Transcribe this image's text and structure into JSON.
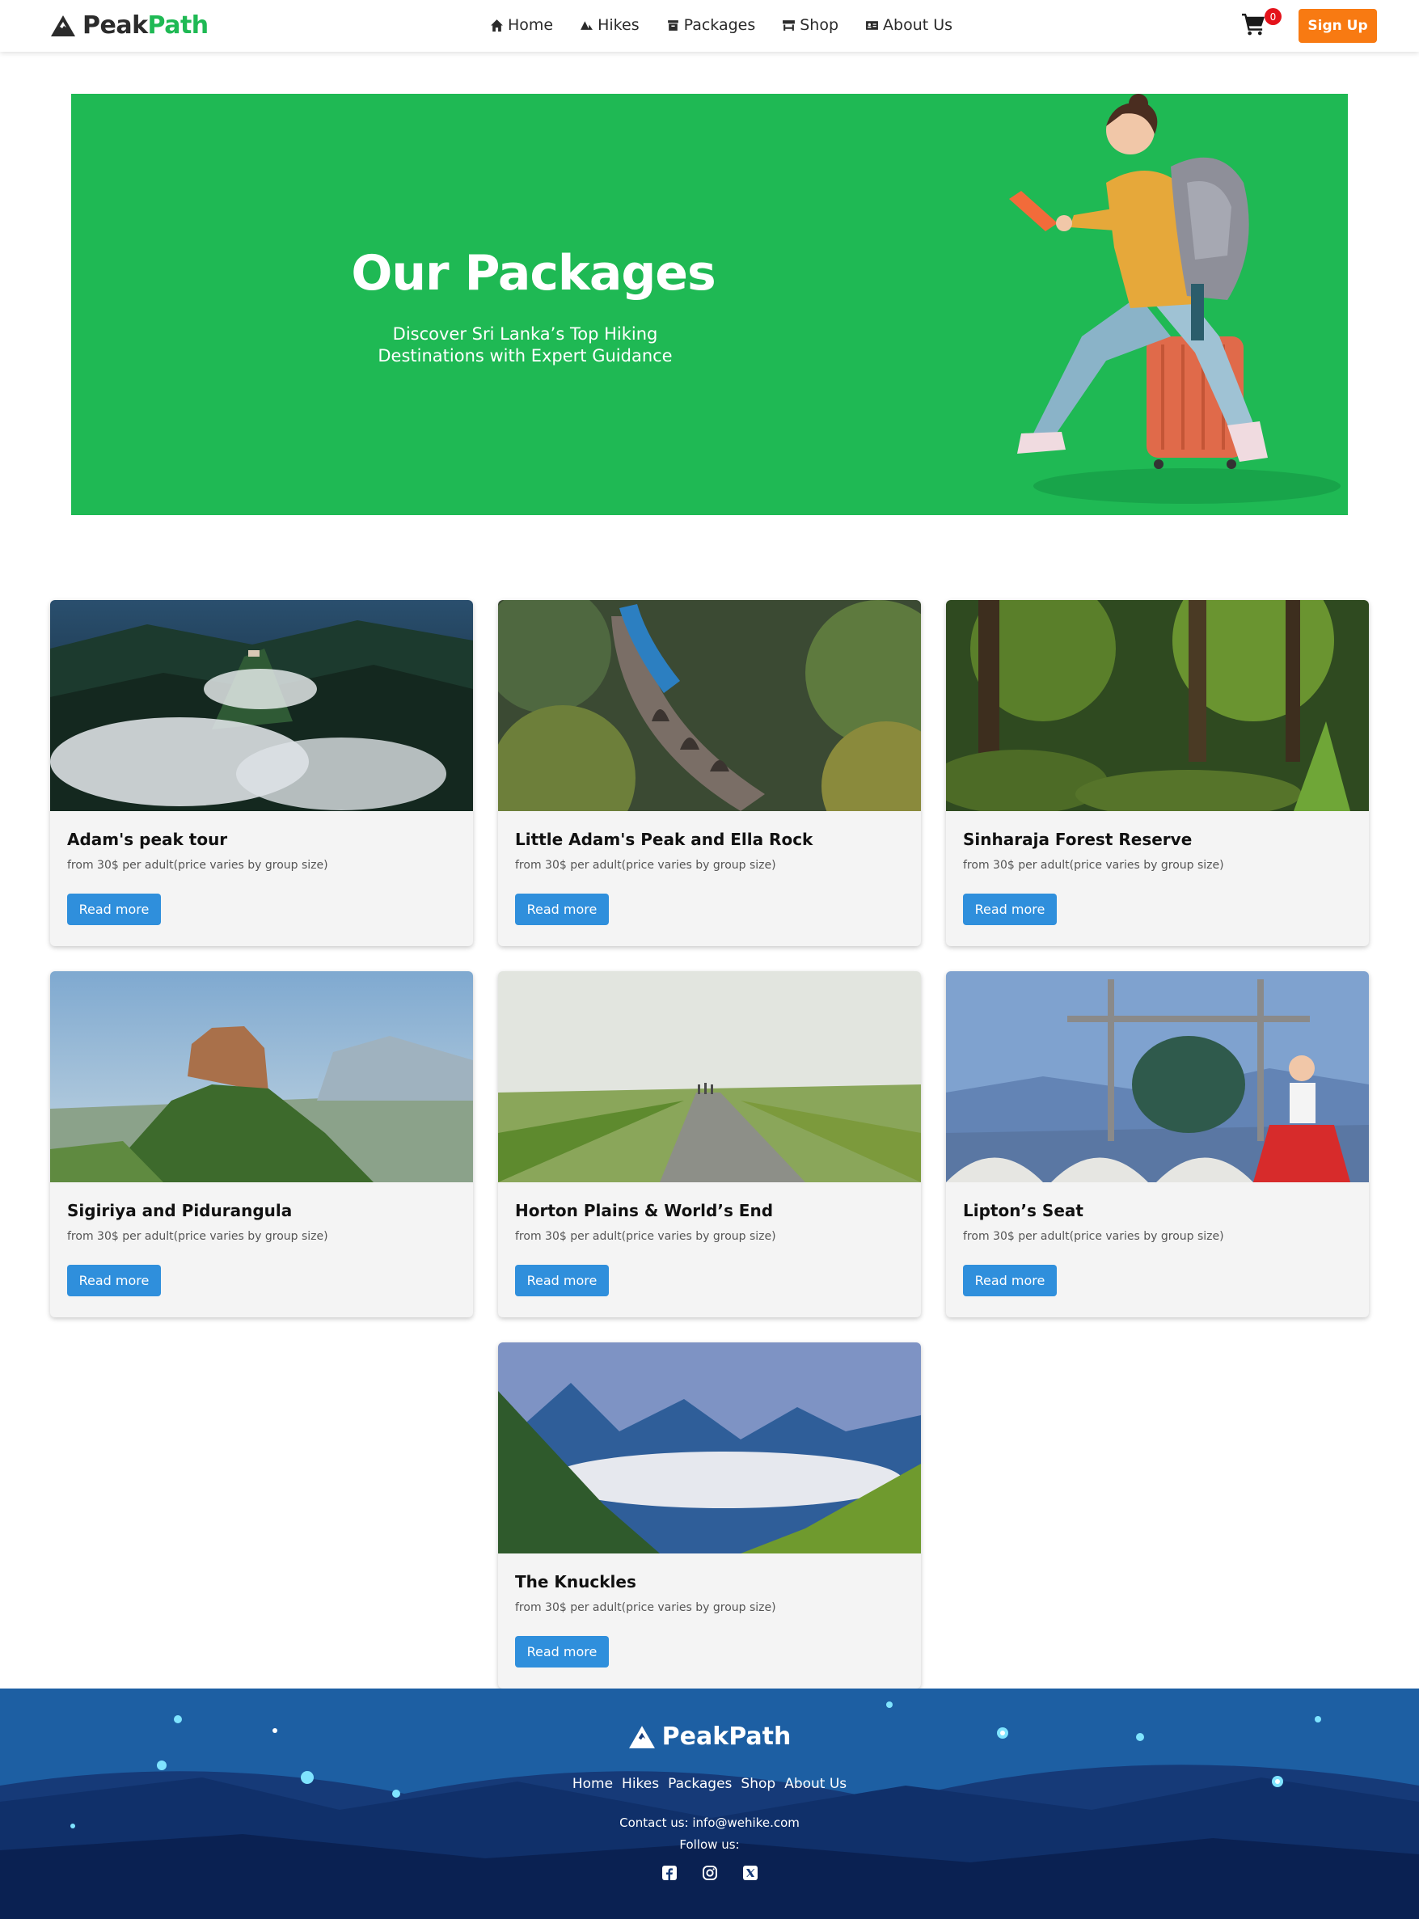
{
  "brand": {
    "name_part1": "Peak",
    "name_part2": "Path",
    "accent": "#1fb954"
  },
  "nav": {
    "items": [
      {
        "label": "Home",
        "icon": "home-icon"
      },
      {
        "label": "Hikes",
        "icon": "mountain-icon"
      },
      {
        "label": "Packages",
        "icon": "box-icon"
      },
      {
        "label": "Shop",
        "icon": "store-icon"
      },
      {
        "label": "About Us",
        "icon": "id-card-icon"
      }
    ],
    "cart_count": "0",
    "signup_label": "Sign Up",
    "signup_color": "#f87a12"
  },
  "hero": {
    "title": "Our Packages",
    "subtitle_line1": "Discover Sri Lanka’s Top Hiking",
    "subtitle_line2": "Destinations with Expert Guidance",
    "bg_color": "#1fb954"
  },
  "packages": [
    {
      "title": "Adam's peak tour",
      "price": "from 30$ per adult(price varies by group size)",
      "button": "Read more"
    },
    {
      "title": "Little Adam's Peak and Ella Rock",
      "price": "from 30$ per adult(price varies by group size)",
      "button": "Read more"
    },
    {
      "title": "Sinharaja Forest Reserve",
      "price": "from 30$ per adult(price varies by group size)",
      "button": "Read more"
    },
    {
      "title": "Sigiriya and Pidurangula",
      "price": "from 30$ per adult(price varies by group size)",
      "button": "Read more"
    },
    {
      "title": "Horton Plains & World’s End",
      "price": "from 30$ per adult(price varies by group size)",
      "button": "Read more"
    },
    {
      "title": "Lipton’s Seat",
      "price": "from 30$ per adult(price varies by group size)",
      "button": "Read more"
    },
    {
      "title": "The Knuckles",
      "price": "from 30$ per adult(price varies by group size)",
      "button": "Read more"
    }
  ],
  "footer": {
    "brand": "PeakPath",
    "links": [
      "Home",
      "Hikes",
      "Packages",
      "Shop",
      "About Us"
    ],
    "contact": "Contact us: info@wehike.com",
    "follow": "Follow us:",
    "socials": [
      "facebook-icon",
      "instagram-icon",
      "x-twitter-icon"
    ]
  },
  "button_color": "#2f8fdc"
}
